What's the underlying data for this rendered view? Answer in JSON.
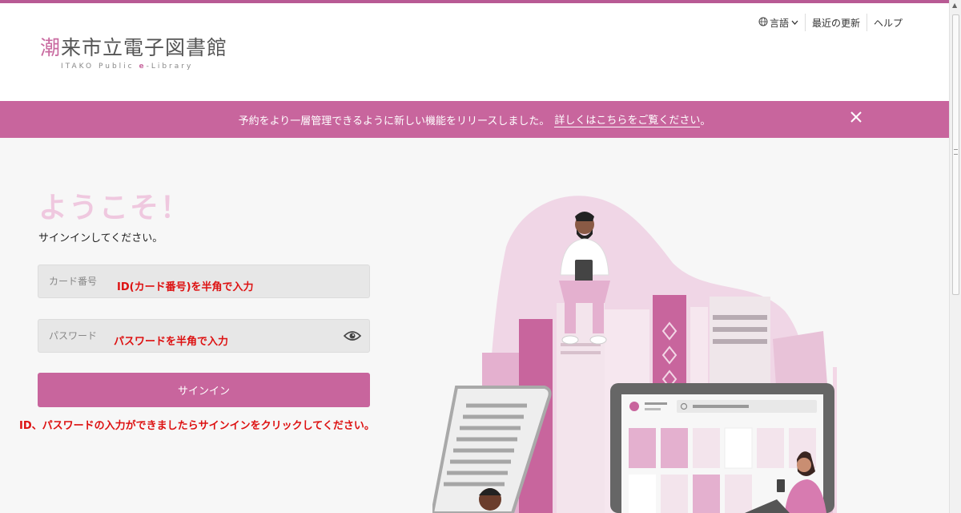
{
  "logo": {
    "first_char": "潮",
    "rest": "来市立電子図書館",
    "sub_pre": "ITAKO Public ",
    "sub_e": "e",
    "sub_post": "-Library"
  },
  "topnav": {
    "language": "言語",
    "recent": "最近の更新",
    "help": "ヘルプ"
  },
  "banner": {
    "text": "予約をより一層管理できるように新しい機能をリリースしました。",
    "link": "詳しくはこちらをご覧ください",
    "link_suffix": "。"
  },
  "welcome": "ようこそ！",
  "subtitle": "サインインしてください。",
  "card_field": {
    "placeholder": "カード番号",
    "annotation": "ID(カード番号)を半角で入力"
  },
  "password_field": {
    "placeholder": "パスワード",
    "annotation": "パスワードを半角で入力"
  },
  "signin_button": "サインイン",
  "instruction": "ID、パスワードの入力ができましたらサインインをクリックしてください。",
  "colors": {
    "accent": "#c8659d",
    "accent_dark": "#b85a94",
    "welcome": "#efc8df",
    "annotation": "#dd1111"
  }
}
